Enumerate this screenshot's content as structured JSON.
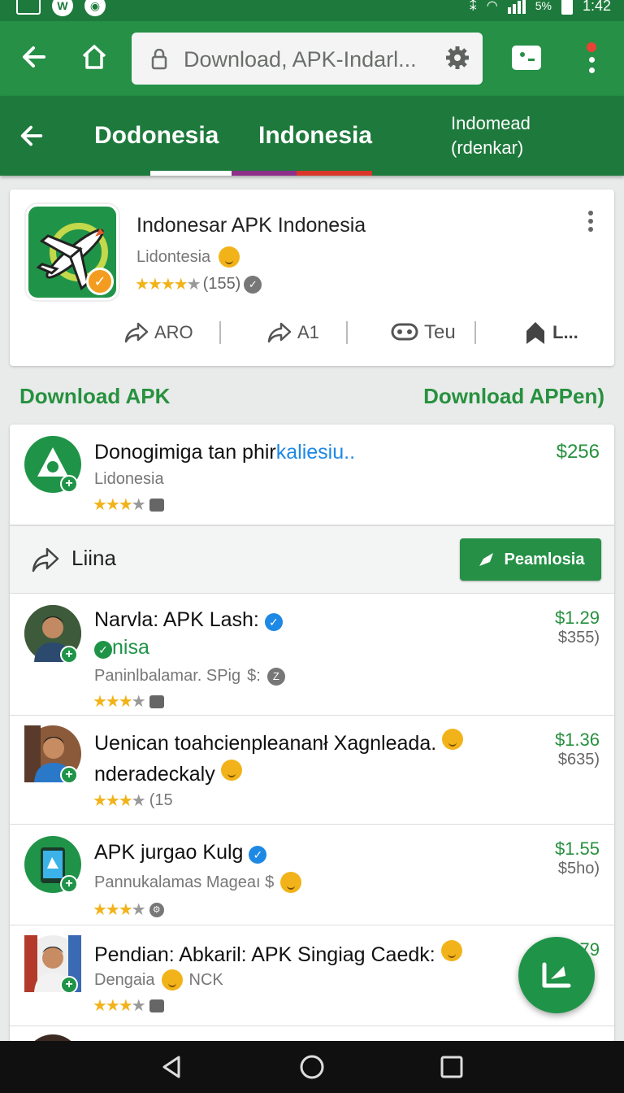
{
  "status_bar": {
    "left_icons": [
      "screen-icon",
      "app-icon-w",
      "app-icon-circle"
    ],
    "battery": "5%",
    "time": "1:42"
  },
  "browser": {
    "url": "Download, APK-Indarl...",
    "icons": [
      "back-arrow-icon",
      "home-icon",
      "lock-icon",
      "gear-icon",
      "card-icon",
      "menu-icon"
    ]
  },
  "tabs": {
    "items": [
      {
        "label": "Dodonesia"
      },
      {
        "label": "Indonesia"
      },
      {
        "label_line1": "Indomead",
        "label_line2": "(rdenkar)"
      }
    ],
    "indicator_colors": [
      "#ffffff",
      "#8e2f8a",
      "#d8362a"
    ]
  },
  "app": {
    "title": "Indonesar APK Indonesia",
    "developer": "Lidontesia",
    "rating_count": "(155)",
    "rating": 4,
    "actions": [
      {
        "icon": "share-icon",
        "label": "ARO"
      },
      {
        "icon": "share-icon",
        "label": "A1"
      },
      {
        "icon": "chat-icon",
        "label": "Teu"
      },
      {
        "icon": "bookmark-icon",
        "label": "L..."
      }
    ]
  },
  "sections": {
    "left": "Download APK",
    "right": "Download APPen)"
  },
  "list": {
    "rows": [
      {
        "title_black": "Donogimiga tan phir",
        "title_blue": "kaliesiu..",
        "sub": "Lidonesia",
        "rating": 3.5,
        "price": "$256",
        "old_price": ""
      },
      {
        "title": "Narvla: APK Lash:",
        "line2": "nisa",
        "sub": "Paninlbalamar. SPig",
        "sub2": "$:",
        "rating": 3.5,
        "price": "$1.29",
        "old_price": "$355)"
      },
      {
        "title": "Uenican toahcienpleananł Xagnleada.",
        "line2": "nderadeckaly",
        "sub": "",
        "rating_text": "(15",
        "rating": 3.5,
        "price": "$1.36",
        "old_price": "$635)"
      },
      {
        "title": "APK jurgao Kulg",
        "sub": "Pannukalamas  Mageaı $",
        "rating": 3.5,
        "price": "$1.55",
        "old_price": "$5ho)"
      },
      {
        "title": "Pendian: Abkaril: APK Singiag Caedk:",
        "sub": "Dengaia",
        "sub2": "NCK",
        "rating": 3.5,
        "price": "$79",
        "old_price": ""
      }
    ],
    "promo": {
      "label": "Liina",
      "button": "Peamlosia"
    }
  },
  "colors": {
    "primary": "#259046",
    "primary_dark": "#1e7a3c",
    "accent_green_text": "#27913f",
    "link_blue": "#1e88e5"
  }
}
